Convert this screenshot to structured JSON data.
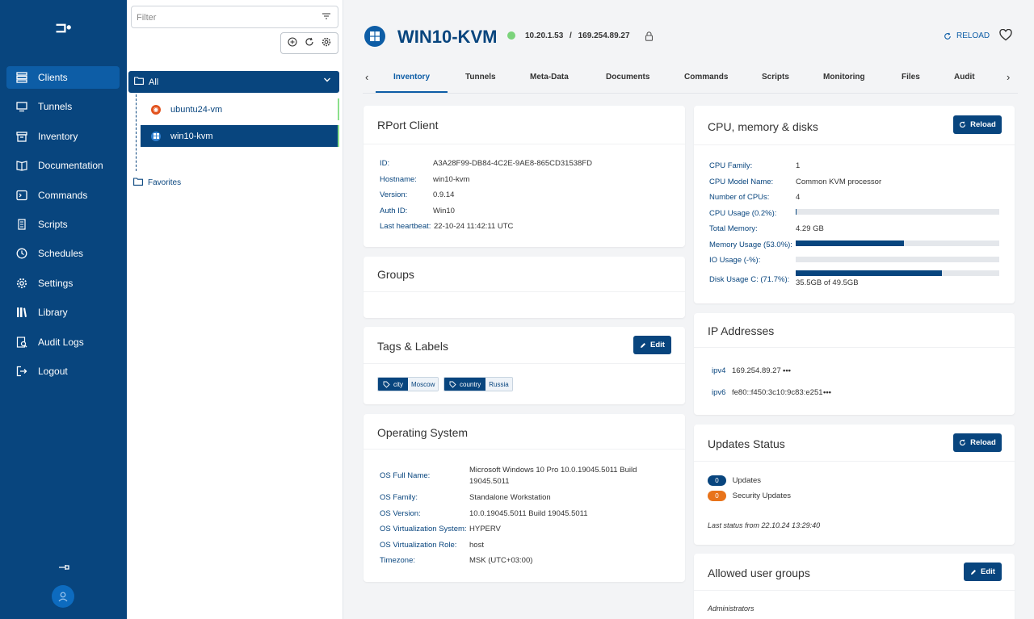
{
  "sidebar": {
    "logo": "⊐•",
    "items": [
      {
        "label": "Clients",
        "icon": "clients-icon",
        "active": true
      },
      {
        "label": "Tunnels",
        "icon": "monitor-icon"
      },
      {
        "label": "Inventory",
        "icon": "inventory-icon"
      },
      {
        "label": "Documentation",
        "icon": "book-icon"
      },
      {
        "label": "Commands",
        "icon": "terminal-icon"
      },
      {
        "label": "Scripts",
        "icon": "scroll-icon"
      },
      {
        "label": "Schedules",
        "icon": "clock-icon"
      },
      {
        "label": "Settings",
        "icon": "gear-icon"
      },
      {
        "label": "Library",
        "icon": "library-icon"
      },
      {
        "label": "Audit Logs",
        "icon": "audit-icon"
      },
      {
        "label": "Logout",
        "icon": "logout-icon"
      }
    ]
  },
  "clients_panel": {
    "filter_placeholder": "Filter",
    "group_label": "All",
    "clients": [
      {
        "name": "ubuntu24-vm",
        "os": "ubuntu"
      },
      {
        "name": "win10-kvm",
        "os": "windows",
        "selected": true
      }
    ],
    "favorites_label": "Favorites"
  },
  "header": {
    "title": "WIN10-KVM",
    "ip_local": "10.20.1.53",
    "ip_sep": "/",
    "ip_public": "169.254.89.27",
    "reload_label": "RELOAD",
    "status_color": "#7bd37b"
  },
  "tabs": [
    "Inventory",
    "Tunnels",
    "Meta-Data",
    "Documents",
    "Commands",
    "Scripts",
    "Monitoring",
    "Files",
    "Audit"
  ],
  "rport_client": {
    "title": "RPort Client",
    "rows": [
      {
        "k": "ID:",
        "v": "A3A28F99-DB84-4C2E-9AE8-865CD31538FD"
      },
      {
        "k": "Hostname:",
        "v": "win10-kvm"
      },
      {
        "k": "Version:",
        "v": "0.9.14"
      },
      {
        "k": "Auth ID:",
        "v": "Win10"
      },
      {
        "k": "Last heartbeat:",
        "v": "22-10-24 11:42:11 UTC"
      }
    ]
  },
  "groups": {
    "title": "Groups"
  },
  "tags": {
    "title": "Tags & Labels",
    "edit_label": "Edit",
    "items": [
      {
        "key": "city",
        "value": "Moscow"
      },
      {
        "key": "country",
        "value": "Russia"
      }
    ]
  },
  "os": {
    "title": "Operating System",
    "rows": [
      {
        "k": "OS Full Name:",
        "v": "Microsoft Windows 10 Pro 10.0.19045.5011 Build",
        "v2": "19045.5011"
      },
      {
        "k": "OS Family:",
        "v": "Standalone Workstation"
      },
      {
        "k": "OS Version:",
        "v": "10.0.19045.5011 Build 19045.5011"
      },
      {
        "k": "OS Virtualization System:",
        "v": "HYPERV"
      },
      {
        "k": "OS Virtualization Role:",
        "v": "host"
      },
      {
        "k": "Timezone:",
        "v": "MSK (UTC+03:00)"
      }
    ]
  },
  "cpu": {
    "title": "CPU, memory & disks",
    "reload_label": "Reload",
    "rows": [
      {
        "k": "CPU Family:",
        "v": "1"
      },
      {
        "k": "CPU Model Name:",
        "v": "Common KVM processor"
      },
      {
        "k": "Number of CPUs:",
        "v": "4"
      },
      {
        "k": "CPU Usage (0.2%):",
        "bar": 0.2
      },
      {
        "k": "Total Memory:",
        "v": "4.29 GB"
      },
      {
        "k": "Memory Usage (53.0%):",
        "bar": 53.0
      },
      {
        "k": "IO Usage (-%):",
        "bar": 0
      },
      {
        "k": "Disk Usage C: (71.7%):",
        "bar": 71.7,
        "sub": "35.5GB of 49.5GB"
      }
    ]
  },
  "ip_addresses": {
    "title": "IP Addresses",
    "rows": [
      {
        "k": "ipv4",
        "v": "169.254.89.27"
      },
      {
        "k": "ipv6",
        "v": "fe80::f450:3c10:9c83:e251"
      }
    ],
    "more": "•••"
  },
  "updates": {
    "title": "Updates Status",
    "reload_label": "Reload",
    "updates_count": "0",
    "updates_label": "Updates",
    "security_count": "0",
    "security_label": "Security Updates",
    "last_status": "Last status from 22.10.24 13:29:40",
    "colors": {
      "updates": "#08457e",
      "security": "#e8731a"
    }
  },
  "allowed_groups": {
    "title": "Allowed user groups",
    "edit_label": "Edit",
    "items": [
      "Administrators"
    ]
  }
}
